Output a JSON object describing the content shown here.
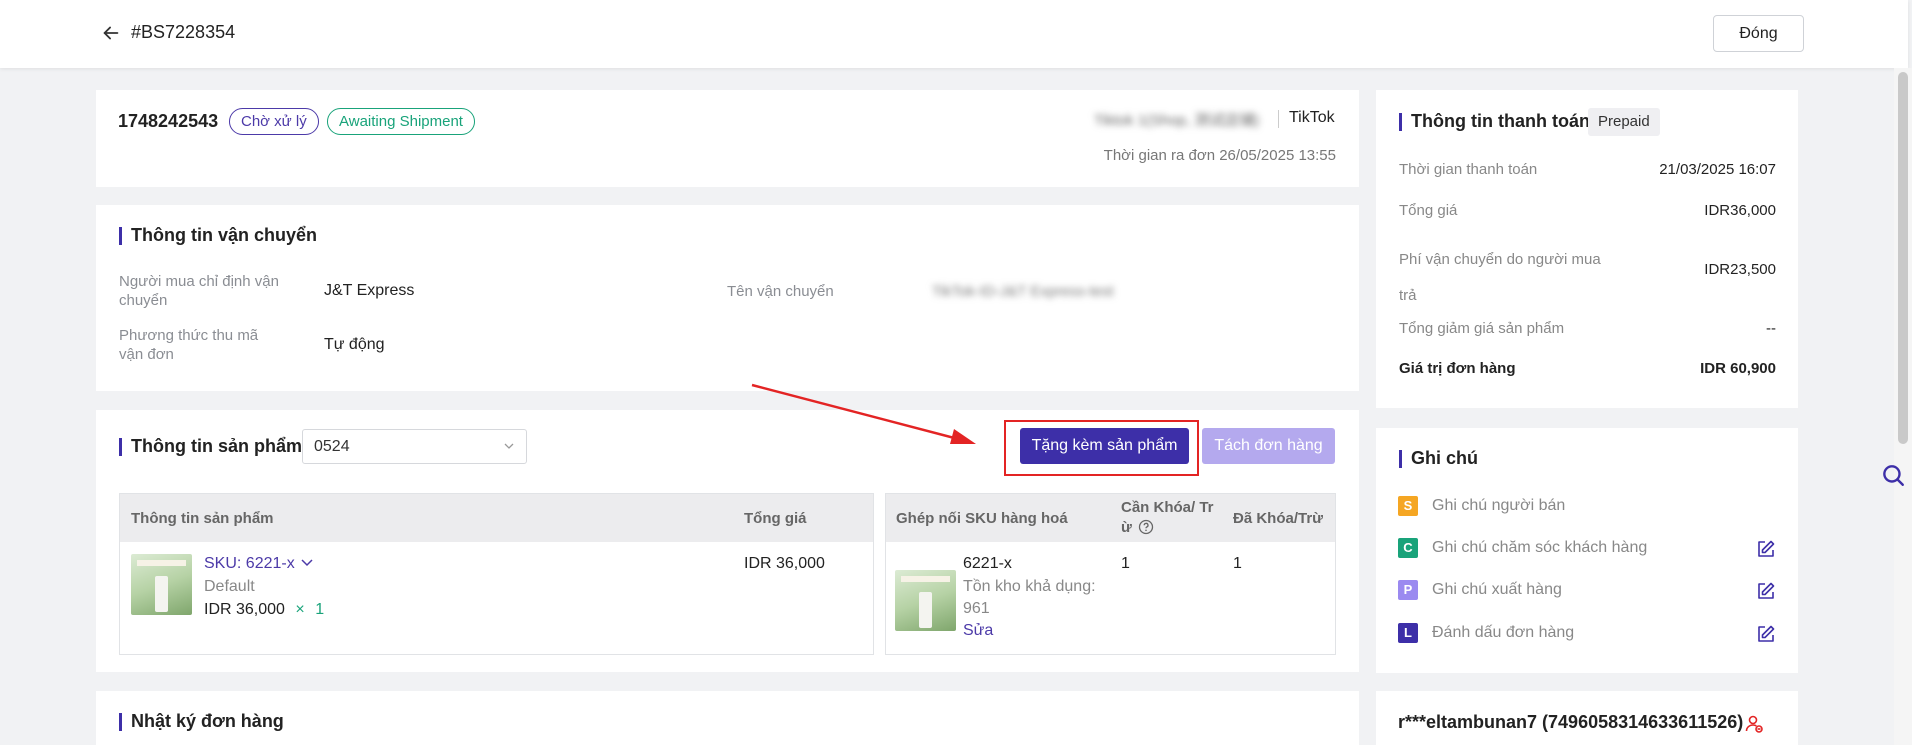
{
  "header": {
    "order_id": "#BS7228354",
    "close_label": "Đóng"
  },
  "order": {
    "number": "1748242543",
    "status_processing": "Chờ xử lý",
    "status_shipment": "Awaiting Shipment",
    "shop_name_blurred": "Tiktok 1(Shop, 测试店铺)",
    "platform": "TikTok",
    "out_time": "Thời gian ra đơn 26/05/2025 13:55"
  },
  "shipping": {
    "title": "Thông tin vận chuyển",
    "buyer_carrier_label": "Người mua chỉ định vận chuyển",
    "buyer_carrier_value": "J&T Express",
    "carrier_name_label": "Tên vận chuyển",
    "carrier_name_value": "TikTok-ID-J&T Express-test",
    "tracking_method_label": "Phương thức thu mã vận đơn",
    "tracking_method_value": "Tự động"
  },
  "products": {
    "title": "Thông tin sản phẩm",
    "warehouse_value": "0524",
    "gift_button": "Tặng kèm sản phẩm",
    "split_button": "Tách đơn hàng",
    "left_table": {
      "col_info": "Thông tin sản phẩm",
      "col_total": "Tổng giá",
      "rows": [
        {
          "sku": "SKU: 6221-x",
          "variant": "Default",
          "price": "IDR 36,000",
          "qty_sign": "×",
          "qty": "1",
          "total": "IDR 36,000"
        }
      ]
    },
    "right_table": {
      "col_pair": "Ghép nối SKU hàng hoá",
      "col_lock_line1": "Cần Khóa/ Tr",
      "col_lock_line2": "ừ",
      "col_locked": "Đã Khóa/Trừ",
      "rows": [
        {
          "sku": "6221-x",
          "stock_label": "Tồn kho khả dụng:",
          "stock_value": "961",
          "edit_link": "Sửa",
          "need_lock": "1",
          "locked": "1"
        }
      ]
    }
  },
  "log": {
    "title": "Nhật ký đơn hàng"
  },
  "payment": {
    "title": "Thông tin thanh toán",
    "tag": "Prepaid",
    "rows": [
      {
        "label": "Thời gian thanh toán",
        "value": "21/03/2025 16:07"
      },
      {
        "label": "Tổng giá",
        "value": "IDR36,000"
      },
      {
        "label_line1": "Phí vận chuyển do người mua",
        "label_line2": "trả",
        "value": "IDR23,500"
      },
      {
        "label": "Tổng giảm giá sản phẩm",
        "value": "--"
      }
    ],
    "total_label": "Giá trị đơn hàng",
    "total_value": "IDR 60,900"
  },
  "notes": {
    "title": "Ghi chú",
    "items": [
      {
        "letter": "S",
        "text": "Ghi chú người bán",
        "color": "#f5a623"
      },
      {
        "letter": "C",
        "text": "Ghi chú chăm sóc khách hàng",
        "color": "#19a37a"
      },
      {
        "letter": "P",
        "text": "Ghi chú xuất hàng",
        "color": "#9b8af0"
      },
      {
        "letter": "L",
        "text": "Đánh dấu đơn hàng",
        "color": "#3d2fa8"
      }
    ]
  },
  "buyer": {
    "name": "r***eltambunan7 (7496058314633611526)"
  }
}
